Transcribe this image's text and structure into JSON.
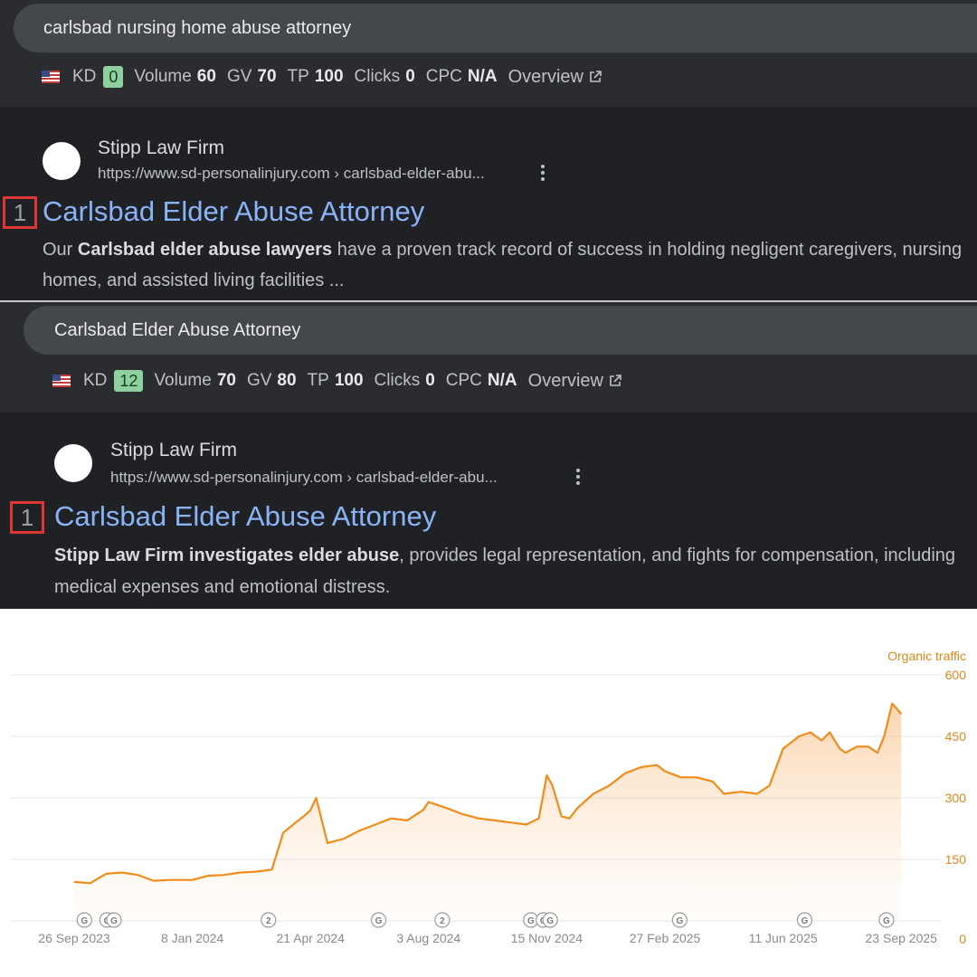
{
  "panel1": {
    "query": "carlsbad nursing home abuse attorney",
    "metrics": {
      "kd_label": "KD",
      "kd_value": "0",
      "volume_label": "Volume",
      "volume_value": "60",
      "gv_label": "GV",
      "gv_value": "70",
      "tp_label": "TP",
      "tp_value": "100",
      "clicks_label": "Clicks",
      "clicks_value": "0",
      "cpc_label": "CPC",
      "cpc_value": "N/A",
      "overview_label": "Overview"
    },
    "result": {
      "site_name": "Stipp Law Firm",
      "url": "https://www.sd-personalinjury.com › carlsbad-elder-abu...",
      "rank": "1",
      "title": "Carlsbad Elder Abuse Attorney",
      "snippet_pre": "Our ",
      "snippet_bold": "Carlsbad elder abuse lawyers",
      "snippet_post": " have a proven track record of success in holding negligent caregivers, nursing homes, and assisted living facilities ..."
    }
  },
  "panel2": {
    "query": "Carlsbad Elder Abuse Attorney",
    "metrics": {
      "kd_label": "KD",
      "kd_value": "12",
      "volume_label": "Volume",
      "volume_value": "70",
      "gv_label": "GV",
      "gv_value": "80",
      "tp_label": "TP",
      "tp_value": "100",
      "clicks_label": "Clicks",
      "clicks_value": "0",
      "cpc_label": "CPC",
      "cpc_value": "N/A",
      "overview_label": "Overview"
    },
    "result": {
      "site_name": "Stipp Law Firm",
      "url": "https://www.sd-personalinjury.com › carlsbad-elder-abu...",
      "rank": "1",
      "title": "Carlsbad Elder Abuse Attorney",
      "snippet_pre": "",
      "snippet_bold": "Stipp Law Firm investigates elder abuse",
      "snippet_post": ", provides legal representation, and fights for compensation, including medical expenses and emotional distress."
    }
  },
  "colors": {
    "dark_bg": "#2b2c2f",
    "result_bg": "#202124",
    "link_blue": "#8ab4f8",
    "kd_green": "#8fd19e",
    "rank_red": "#e03535",
    "traffic_orange": "#f08c1a"
  },
  "chart_data": {
    "type": "area",
    "series": [
      {
        "name": "Organic traffic",
        "x": [
          "2023-09-26",
          "2023-10-10",
          "2023-10-24",
          "2023-11-07",
          "2023-11-21",
          "2023-12-05",
          "2023-12-19",
          "2024-01-08",
          "2024-01-22",
          "2024-02-05",
          "2024-02-19",
          "2024-03-04",
          "2024-03-18",
          "2024-03-28",
          "2024-04-08",
          "2024-04-15",
          "2024-04-21",
          "2024-04-26",
          "2024-05-06",
          "2024-05-20",
          "2024-06-03",
          "2024-06-17",
          "2024-07-01",
          "2024-07-15",
          "2024-07-29",
          "2024-08-03",
          "2024-08-19",
          "2024-09-02",
          "2024-09-16",
          "2024-09-30",
          "2024-10-14",
          "2024-10-28",
          "2024-11-08",
          "2024-11-15",
          "2024-11-20",
          "2024-11-28",
          "2024-12-05",
          "2024-12-12",
          "2024-12-26",
          "2025-01-09",
          "2025-01-23",
          "2025-02-06",
          "2025-02-20",
          "2025-02-27",
          "2025-03-13",
          "2025-03-27",
          "2025-04-10",
          "2025-04-20",
          "2025-05-05",
          "2025-05-19",
          "2025-05-30",
          "2025-06-11",
          "2025-06-25",
          "2025-07-05",
          "2025-07-15",
          "2025-07-22",
          "2025-07-31",
          "2025-08-05",
          "2025-08-15",
          "2025-08-25",
          "2025-09-02",
          "2025-09-08",
          "2025-09-15",
          "2025-09-23"
        ],
        "y": [
          95,
          92,
          115,
          118,
          112,
          98,
          100,
          100,
          110,
          112,
          118,
          120,
          125,
          215,
          240,
          255,
          270,
          300,
          190,
          200,
          220,
          235,
          250,
          245,
          270,
          290,
          275,
          260,
          250,
          245,
          240,
          235,
          250,
          355,
          330,
          255,
          250,
          275,
          310,
          330,
          360,
          375,
          380,
          365,
          350,
          350,
          340,
          310,
          315,
          310,
          330,
          420,
          450,
          460,
          440,
          460,
          420,
          410,
          425,
          425,
          410,
          450,
          530,
          505
        ]
      }
    ],
    "x_tick_labels": [
      "26 Sep 2023",
      "8 Jan 2024",
      "21 Apr 2024",
      "3 Aug 2024",
      "15 Nov 2024",
      "27 Feb 2025",
      "11 Jun 2025",
      "23 Sep 2025"
    ],
    "y_tick_labels": [
      "0",
      "150",
      "300",
      "450",
      "600"
    ],
    "ylim": [
      0,
      600
    ],
    "y_axis_side": "right",
    "y_axis_title": "Organic traffic",
    "grid": true,
    "legend": "none",
    "annotations": [
      {
        "date": "2023-10-05",
        "label": "G"
      },
      {
        "date": "2023-10-25",
        "label": "G"
      },
      {
        "date": "2023-10-31",
        "label": "G"
      },
      {
        "date": "2024-03-15",
        "label": "2"
      },
      {
        "date": "2024-06-20",
        "label": "G"
      },
      {
        "date": "2024-08-15",
        "label": "2"
      },
      {
        "date": "2024-11-01",
        "label": "G"
      },
      {
        "date": "2024-11-12",
        "label": "G"
      },
      {
        "date": "2024-11-18",
        "label": "G"
      },
      {
        "date": "2025-03-12",
        "label": "G"
      },
      {
        "date": "2025-06-30",
        "label": "G"
      },
      {
        "date": "2025-09-10",
        "label": "G"
      }
    ]
  }
}
